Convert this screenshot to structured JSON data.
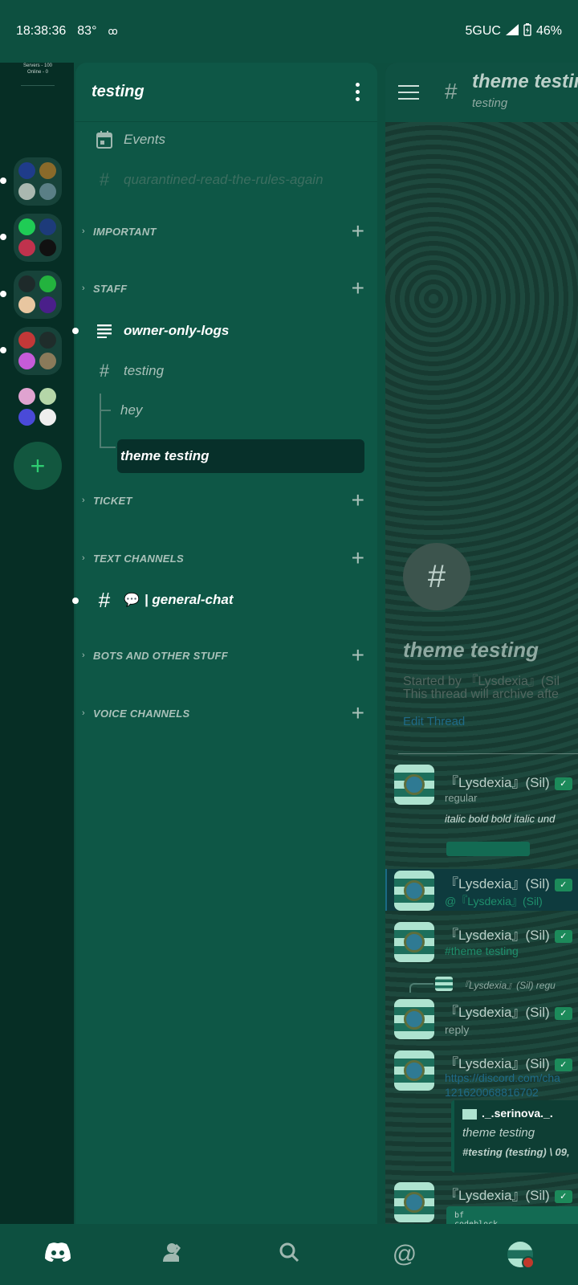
{
  "status_bar": {
    "time": "18:38:36",
    "temp": "83°",
    "network": "5GUC",
    "battery": "46%"
  },
  "rail": {
    "stats_line1": "Servers - 100",
    "stats_line2": "Online - 0",
    "folders": [
      {
        "colors": [
          "#1f3c8a",
          "#8a6a2a",
          "#aab8b0",
          "#5a7f86"
        ]
      },
      {
        "colors": [
          "#1fcc55",
          "#1d3b7a",
          "#c0324d",
          "#111111"
        ]
      },
      {
        "colors": [
          "#1e2a2a",
          "#23b33e",
          "#e8c6a0",
          "#4a1f8a"
        ]
      },
      {
        "colors": [
          "#c23838",
          "#1f2d2b",
          "#c65bd8",
          "#8a7a5a"
        ]
      },
      {
        "colors": [
          "#e0a3d0",
          "#b5d6a8",
          "#4a4ad8",
          "#eeeeee"
        ]
      }
    ],
    "add_label": "+"
  },
  "channels": {
    "server_name": "testing",
    "events_label": "Events",
    "quarantine_label": "quarantined-read-the-rules-again",
    "categories": {
      "important": "IMPORTANT",
      "staff": "STAFF",
      "ticket": "TICKET",
      "text": "TEXT CHANNELS",
      "bots": "BOTS AND OTHER STUFF",
      "voice": "VOICE CHANNELS"
    },
    "owner_logs": "owner-only-logs",
    "forum_testing": "testing",
    "thread_hey": "hey",
    "thread_theme": "theme testing",
    "general_chat": "| general-chat",
    "general_emoji": "💬"
  },
  "chat": {
    "title": "theme testing",
    "subtitle": "testing",
    "thread_name": "theme testing",
    "started_by": "Started by 『Lysdexia』(Sil",
    "archive_note": "This thread will archive afte",
    "edit_thread": "Edit Thread",
    "messages": [
      {
        "name": "『Lysdexia』(Sil)",
        "line1": "regular",
        "line2": "italic bold bold italic und"
      },
      {
        "name": "『Lysdexia』(Sil)",
        "line1": "@『Lysdexia』(Sil)"
      },
      {
        "name": "『Lysdexia』(Sil)",
        "line1": "#theme testing"
      },
      {
        "reply_ref": "『Lysdexia』(Sil) regu"
      },
      {
        "name": "『Lysdexia』(Sil)",
        "line1": "reply"
      },
      {
        "name": "『Lysdexia』(Sil)",
        "line1": "https://discord.com/cha",
        "line2": "121620068816702"
      },
      {
        "name": "『Lysdexia』(Sil)",
        "code1": "bf",
        "code2": "codeblock"
      }
    ],
    "embed": {
      "author": "._.serinova._.",
      "text": "theme testing",
      "footer": "#testing (testing) \\ 09,"
    },
    "badge_check": "✓"
  },
  "nav": {
    "home": "home-icon",
    "friends": "friends-icon",
    "search": "search-icon",
    "mentions": "mentions-icon",
    "profile": "avatar"
  },
  "colors": {
    "accent": "#2ecc71",
    "panel": "#0e5746",
    "rail": "#062e25"
  }
}
